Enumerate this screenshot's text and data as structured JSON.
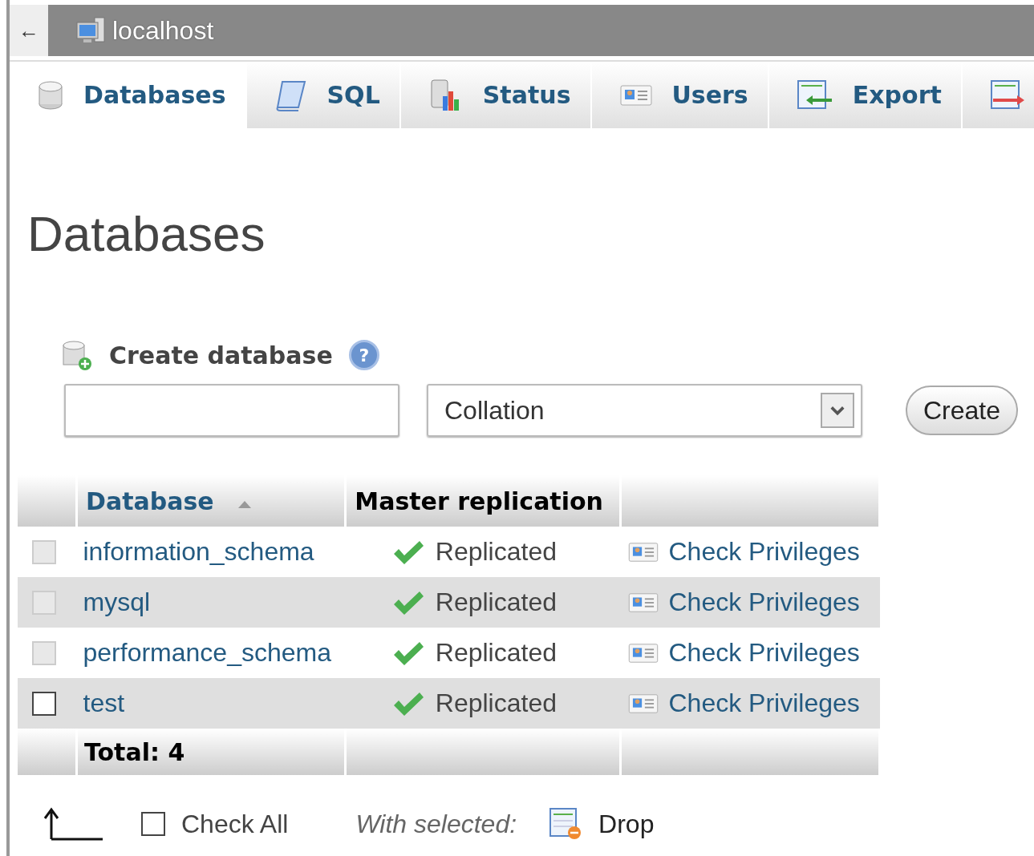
{
  "topbar": {
    "back": "←",
    "server": "localhost"
  },
  "tabs": [
    {
      "label": "Databases",
      "selected": true
    },
    {
      "label": "SQL",
      "selected": false
    },
    {
      "label": "Status",
      "selected": false
    },
    {
      "label": "Users",
      "selected": false
    },
    {
      "label": "Export",
      "selected": false
    },
    {
      "selected": false
    }
  ],
  "page_title": "Databases",
  "create": {
    "title": "Create database",
    "help": "?",
    "collation": "Collation",
    "button": "Create"
  },
  "table": {
    "columns": [
      {
        "label": "Database",
        "sorted": true,
        "sortable": true
      },
      {
        "label": "Master replication",
        "sorted": false,
        "sortable": false
      }
    ],
    "rows": [
      {
        "name": "information_schema",
        "checked": false,
        "disabled": true,
        "replication": "Replicated",
        "action": "Check Privileges"
      },
      {
        "name": "mysql",
        "checked": false,
        "disabled": true,
        "replication": "Replicated",
        "action": "Check Privileges"
      },
      {
        "name": "performance_schema",
        "checked": false,
        "disabled": true,
        "replication": "Replicated",
        "action": "Check Privileges"
      },
      {
        "name": "test",
        "checked": false,
        "disabled": false,
        "replication": "Replicated",
        "action": "Check Privileges"
      }
    ],
    "total": "Total: 4"
  },
  "footer": {
    "check_all": "Check All",
    "check_all_checked": false,
    "with_selected": "With selected:",
    "drop": "Drop"
  }
}
